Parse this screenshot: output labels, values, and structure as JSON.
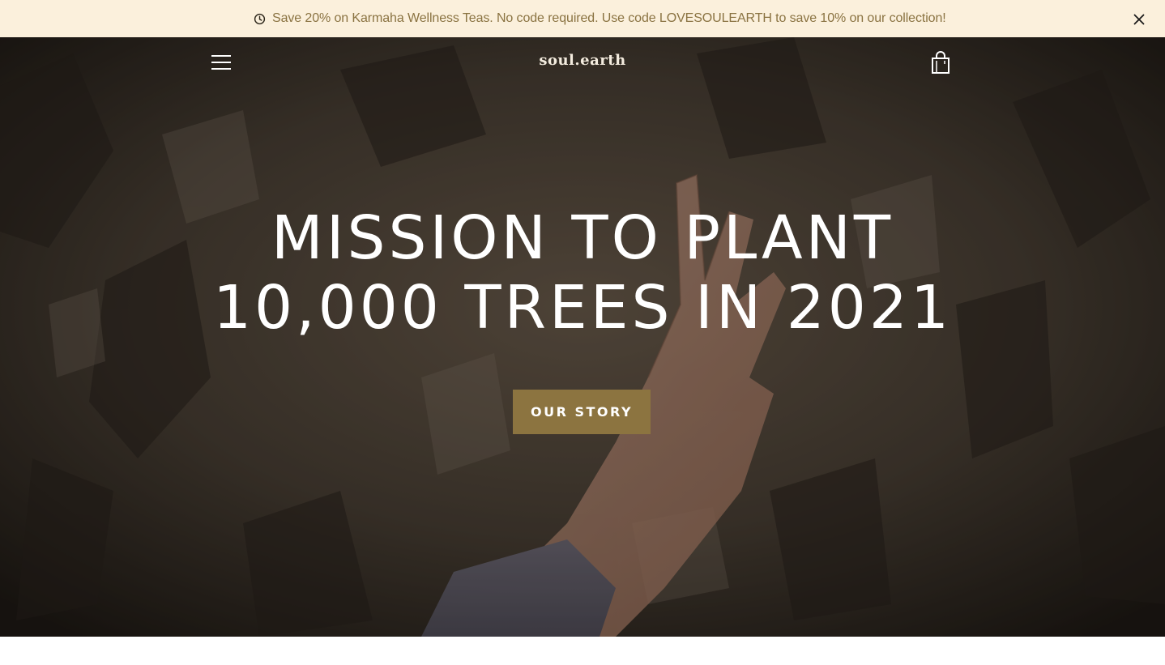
{
  "announcement": {
    "icon": "clock-icon",
    "text": "Save 20% on Karmaha Wellness Teas. No code required. Use code LOVESOULEARTH to save 10% on our collection!",
    "close_icon": "close-icon"
  },
  "header": {
    "menu_icon": "hamburger-menu-icon",
    "logo": "soul.earth",
    "cart_icon": "shopping-bag-icon"
  },
  "hero": {
    "headline_line1": "MISSION TO PLANT",
    "headline_line2": "10,000 TREES IN 2021",
    "cta_label": "OUR STORY"
  },
  "colors": {
    "announcement_bg": "#fbf0dc",
    "announcement_text": "#8a7342",
    "cta_bg": "#8c7440",
    "hero_text": "#ffffff"
  }
}
